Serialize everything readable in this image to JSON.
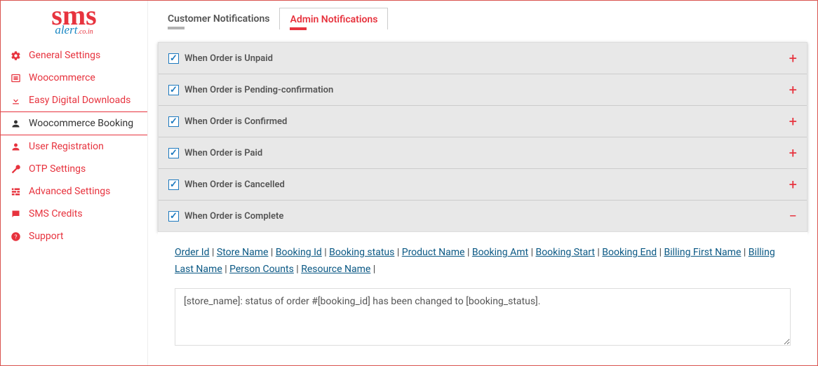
{
  "brand": {
    "sms": "sms",
    "tag_alert": "alert",
    "tag_coin": ".co.in"
  },
  "sidebar": {
    "items": [
      {
        "label": "General Settings"
      },
      {
        "label": "Woocommerce"
      },
      {
        "label": "Easy Digital Downloads"
      },
      {
        "label": "Woocommerce Booking"
      },
      {
        "label": "User Registration"
      },
      {
        "label": "OTP Settings"
      },
      {
        "label": "Advanced Settings"
      },
      {
        "label": "SMS Credits"
      },
      {
        "label": "Support"
      }
    ]
  },
  "tabs": {
    "customer": "Customer Notifications",
    "admin": "Admin Notifications"
  },
  "accordion": [
    {
      "title": "When Order is Unpaid",
      "checked": true,
      "expanded": false
    },
    {
      "title": "When Order is Pending-confirmation",
      "checked": true,
      "expanded": false
    },
    {
      "title": "When Order is Confirmed",
      "checked": true,
      "expanded": false
    },
    {
      "title": "When Order is Paid",
      "checked": true,
      "expanded": false
    },
    {
      "title": "When Order is Cancelled",
      "checked": true,
      "expanded": false
    },
    {
      "title": "When Order is Complete",
      "checked": true,
      "expanded": true
    }
  ],
  "tokens": [
    "Order Id",
    "Store Name",
    "Booking Id",
    "Booking status",
    "Product Name",
    "Booking Amt",
    "Booking Start",
    "Booking End",
    "Billing First Name",
    "Billing Last Name",
    "Person Counts",
    "Resource Name"
  ],
  "message_template": "[store_name]: status of order #[booking_id] has been changed to [booking_status].",
  "glyphs": {
    "plus": "+",
    "minus": "−",
    "sep": " | "
  }
}
